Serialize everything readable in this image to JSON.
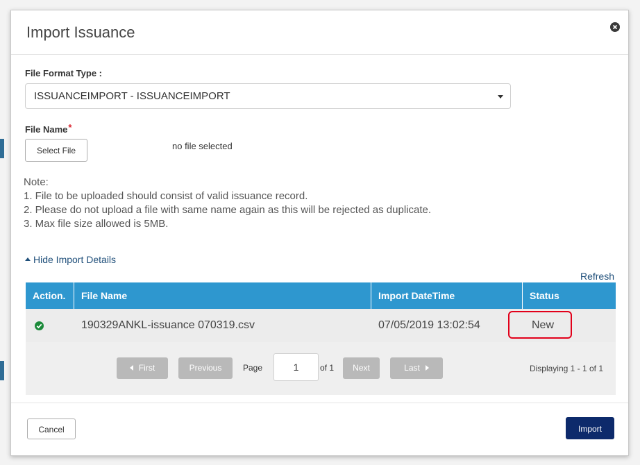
{
  "modal": {
    "title": "Import Issuance"
  },
  "form": {
    "format_label": "File Format Type :",
    "format_value": "ISSUANCEIMPORT - ISSUANCEIMPORT",
    "file_name_label": "File Name",
    "required_mark": "*",
    "select_file_label": "Select File",
    "no_file_text": "no file selected"
  },
  "notes": {
    "heading": "Note:",
    "lines": [
      "1. File to be uploaded should consist of valid issuance record.",
      "2. Please do not upload a file with same name again as this will be rejected as duplicate.",
      "3. Max file size allowed is 5MB."
    ]
  },
  "details": {
    "toggle_label": "Hide Import Details",
    "refresh_label": "Refresh"
  },
  "grid": {
    "columns": [
      "Action.",
      "File Name",
      "Import DateTime",
      "Status"
    ],
    "rows": [
      {
        "action_icon": "check-circle-icon",
        "file_name": "190329ANKL-issuance 070319.csv",
        "import_datetime": "07/05/2019 13:02:54",
        "status": "New"
      }
    ],
    "highlight_color": "#e2001a",
    "header_color": "#2e97cf"
  },
  "pager": {
    "first_label": "First",
    "previous_label": "Previous",
    "page_label": "Page",
    "page_value": "1",
    "of_label": "of 1",
    "next_label": "Next",
    "last_label": "Last",
    "displaying_text": "Displaying 1 - 1 of 1"
  },
  "footer": {
    "cancel_label": "Cancel",
    "import_label": "Import",
    "import_color": "#0d2a6b"
  }
}
